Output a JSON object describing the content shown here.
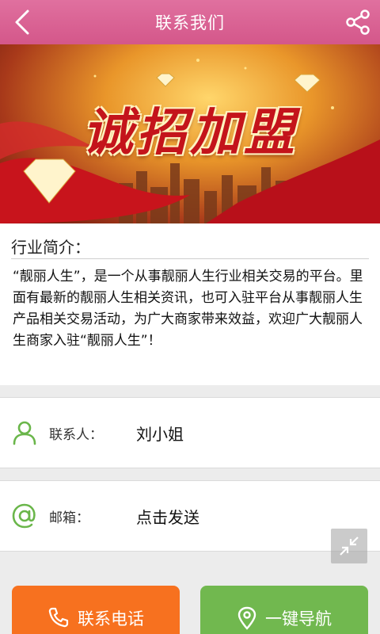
{
  "header": {
    "title": "联系我们",
    "back_icon": "chevron-left-icon",
    "share_icon": "share-icon"
  },
  "banner": {
    "text": "诚招加盟"
  },
  "intro": {
    "heading": "行业简介：",
    "description": "“靓丽人生”，是一个从事靓丽人生行业相关交易的平台。里面有最新的靓丽人生相关资讯，也可入驻平台从事靓丽人生产品相关交易活动，为广大商家带来效益，欢迎广大靓丽人生商家入驻“靓丽人生”！"
  },
  "contact": {
    "label": "联系人：",
    "value": "刘小姐",
    "icon": "person-icon"
  },
  "email": {
    "label": "邮箱：",
    "value": "点击发送",
    "icon": "at-icon"
  },
  "buttons": {
    "call_label": "联系电话",
    "nav_label": "一键导航"
  },
  "colors": {
    "header": "#d95b8e",
    "call_button": "#f7711f",
    "nav_button": "#71b84f",
    "icon_green": "#6ab64a"
  }
}
